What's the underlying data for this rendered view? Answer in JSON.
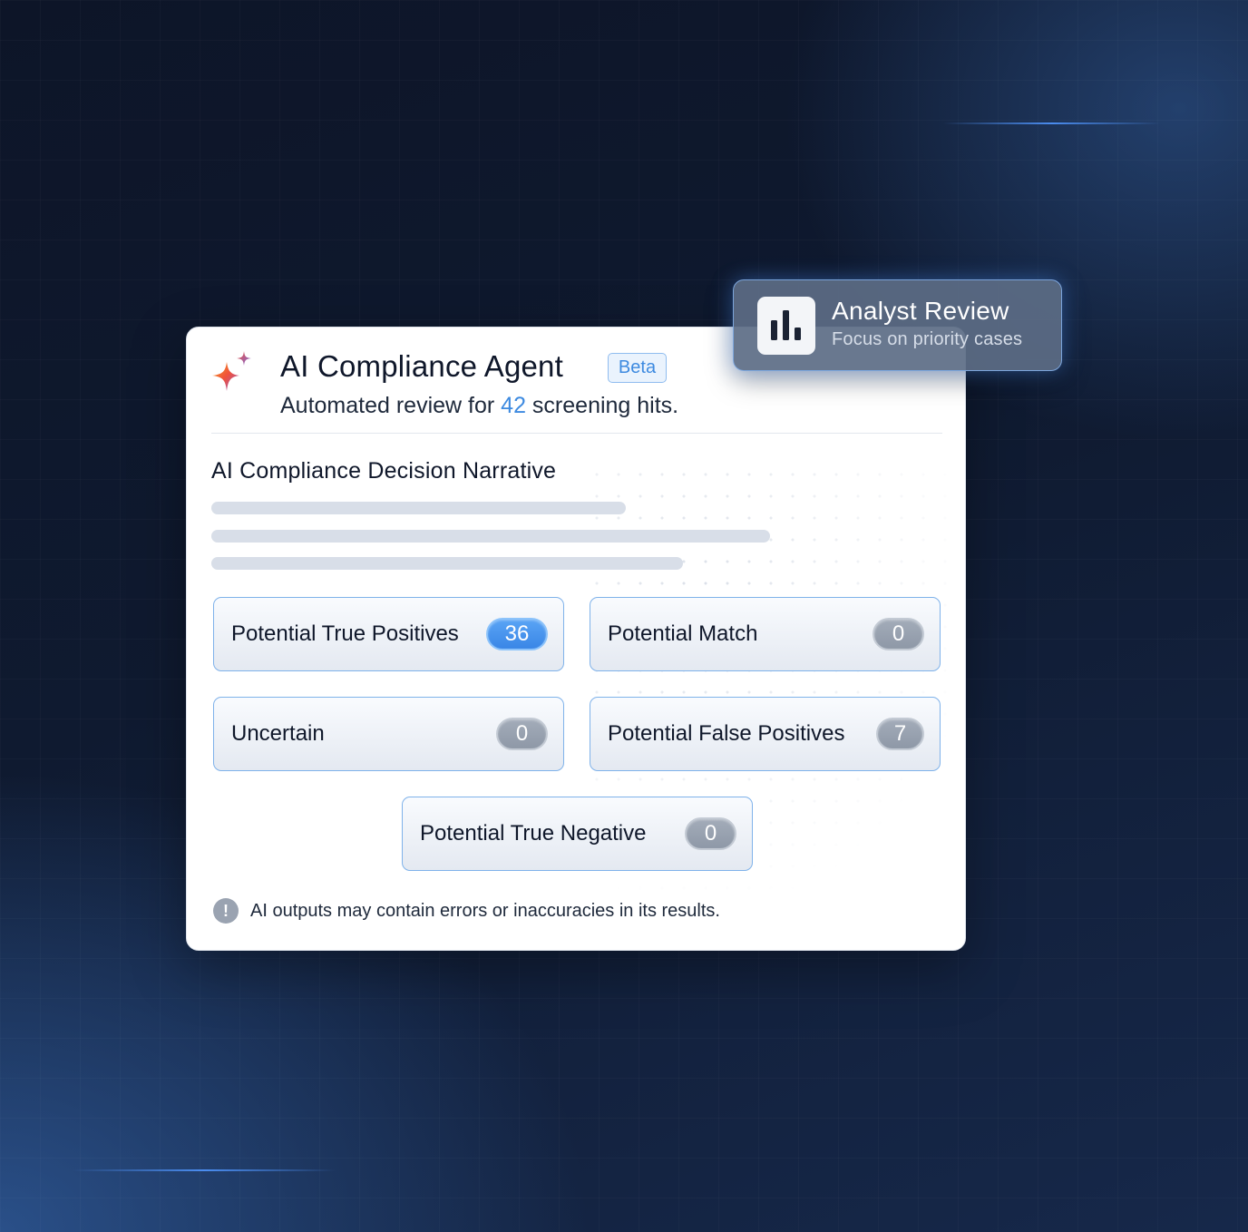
{
  "agent": {
    "title": "AI Compliance Agent",
    "badge": "Beta",
    "subtitle_prefix": "Automated review for ",
    "hit_count": "42",
    "subtitle_suffix": " screening hits."
  },
  "narrative": {
    "title": "AI Compliance Decision Narrative"
  },
  "categories": [
    {
      "label": "Potential True Positives",
      "count": "36"
    },
    {
      "label": "Potential Match",
      "count": "0"
    },
    {
      "label": "Uncertain",
      "count": "0"
    },
    {
      "label": "Potential False Positives",
      "count": "7"
    },
    {
      "label": "Potential True Negative",
      "count": "0"
    }
  ],
  "disclaimer": {
    "icon": "!",
    "text": "AI outputs may contain errors or inaccuracies in its results."
  },
  "review": {
    "title": "Analyst Review",
    "subtitle": "Focus on priority cases"
  },
  "colors": {
    "accent": "#3d8ae0",
    "pill_active": "#4a95ee",
    "pill_inactive": "#9aa3b1"
  }
}
